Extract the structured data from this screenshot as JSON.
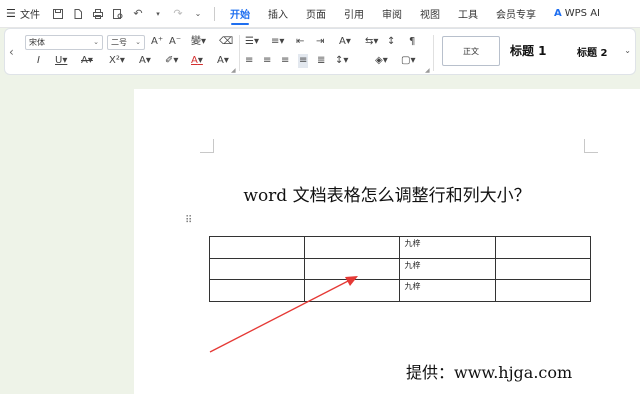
{
  "menubar": {
    "file_label": "文件",
    "tabs": [
      {
        "label": "开始",
        "active": true
      },
      {
        "label": "插入"
      },
      {
        "label": "页面"
      },
      {
        "label": "引用"
      },
      {
        "label": "审阅"
      },
      {
        "label": "视图"
      },
      {
        "label": "工具"
      },
      {
        "label": "会员专享"
      },
      {
        "label": "WPS AI"
      }
    ]
  },
  "ribbon": {
    "font_name": "宋体",
    "font_size": "二号",
    "styles": {
      "normal": "正文",
      "heading1": "标题 1",
      "heading2": "标题 2"
    }
  },
  "document": {
    "title": "word 文档表格怎么调整行和列大小？",
    "table": [
      [
        "",
        "",
        "九梓",
        ""
      ],
      [
        "",
        "",
        "九梓",
        ""
      ],
      [
        "",
        "",
        "九梓",
        ""
      ]
    ],
    "credit": "提供：www.hjga.com"
  },
  "colors": {
    "accent": "#1f6ff0",
    "arrow": "#e53935",
    "background": "#eef3e8"
  }
}
